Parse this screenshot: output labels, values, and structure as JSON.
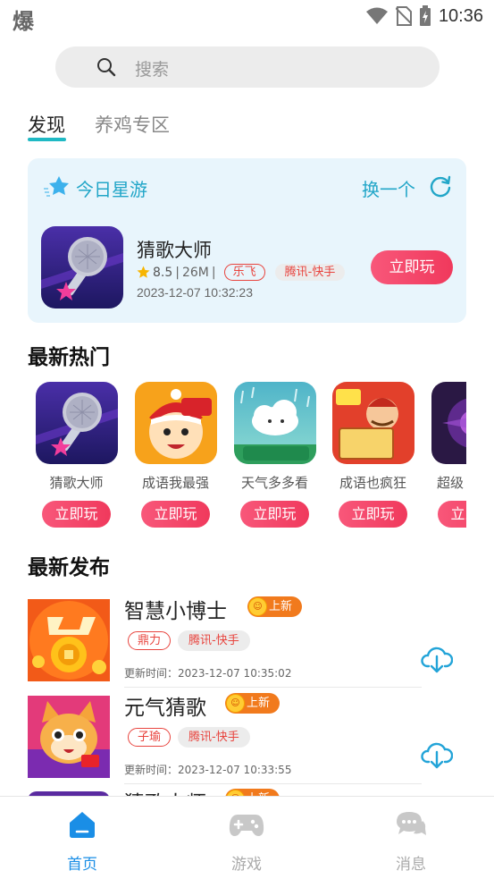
{
  "status_bar": {
    "app_glyph": "爆",
    "time": "10:36"
  },
  "search": {
    "placeholder": "搜索"
  },
  "tabs": [
    {
      "label": "发现",
      "active": true
    },
    {
      "label": "养鸡专区",
      "active": false
    }
  ],
  "featured": {
    "title": "今日星游",
    "swap_label": "换一个",
    "game": {
      "name": "猜歌大师",
      "score": "8.5",
      "size": "26M",
      "tag": "乐飞",
      "platform": "腾讯-快手",
      "time": "2023-12-07 10:32:23",
      "play_label": "立即玩"
    }
  },
  "hot": {
    "title": "最新热门",
    "items": [
      {
        "name": "猜歌大师",
        "play_label": "立即玩"
      },
      {
        "name": "成语我最强",
        "play_label": "立即玩"
      },
      {
        "name": "天气多多看",
        "play_label": "立即玩"
      },
      {
        "name": "成语也疯狂",
        "play_label": "立即玩"
      },
      {
        "name": "超级",
        "play_label": "立即玩"
      }
    ]
  },
  "releases": {
    "title": "最新发布",
    "items": [
      {
        "name": "智慧小博士",
        "badge": "上新",
        "tag": "鼎力",
        "platform": "腾讯-快手",
        "time": "更新时间：2023-12-07 10:35:02"
      },
      {
        "name": "元气猜歌",
        "badge": "上新",
        "tag": "子瑜",
        "platform": "腾讯-快手",
        "time": "更新时间：2023-12-07 10:33:55"
      },
      {
        "name": "猜歌大师",
        "badge": "上新"
      }
    ]
  },
  "bottom_nav": [
    {
      "label": "首页",
      "icon": "home-icon",
      "active": true
    },
    {
      "label": "游戏",
      "icon": "gamepad-icon",
      "active": false
    },
    {
      "label": "消息",
      "icon": "chat-icon",
      "active": false
    }
  ],
  "colors": {
    "accent": "#1fb9c4",
    "play_button": "#f0395c",
    "nav_active": "#1a8ee6",
    "new_badge": "#f17a1d"
  }
}
